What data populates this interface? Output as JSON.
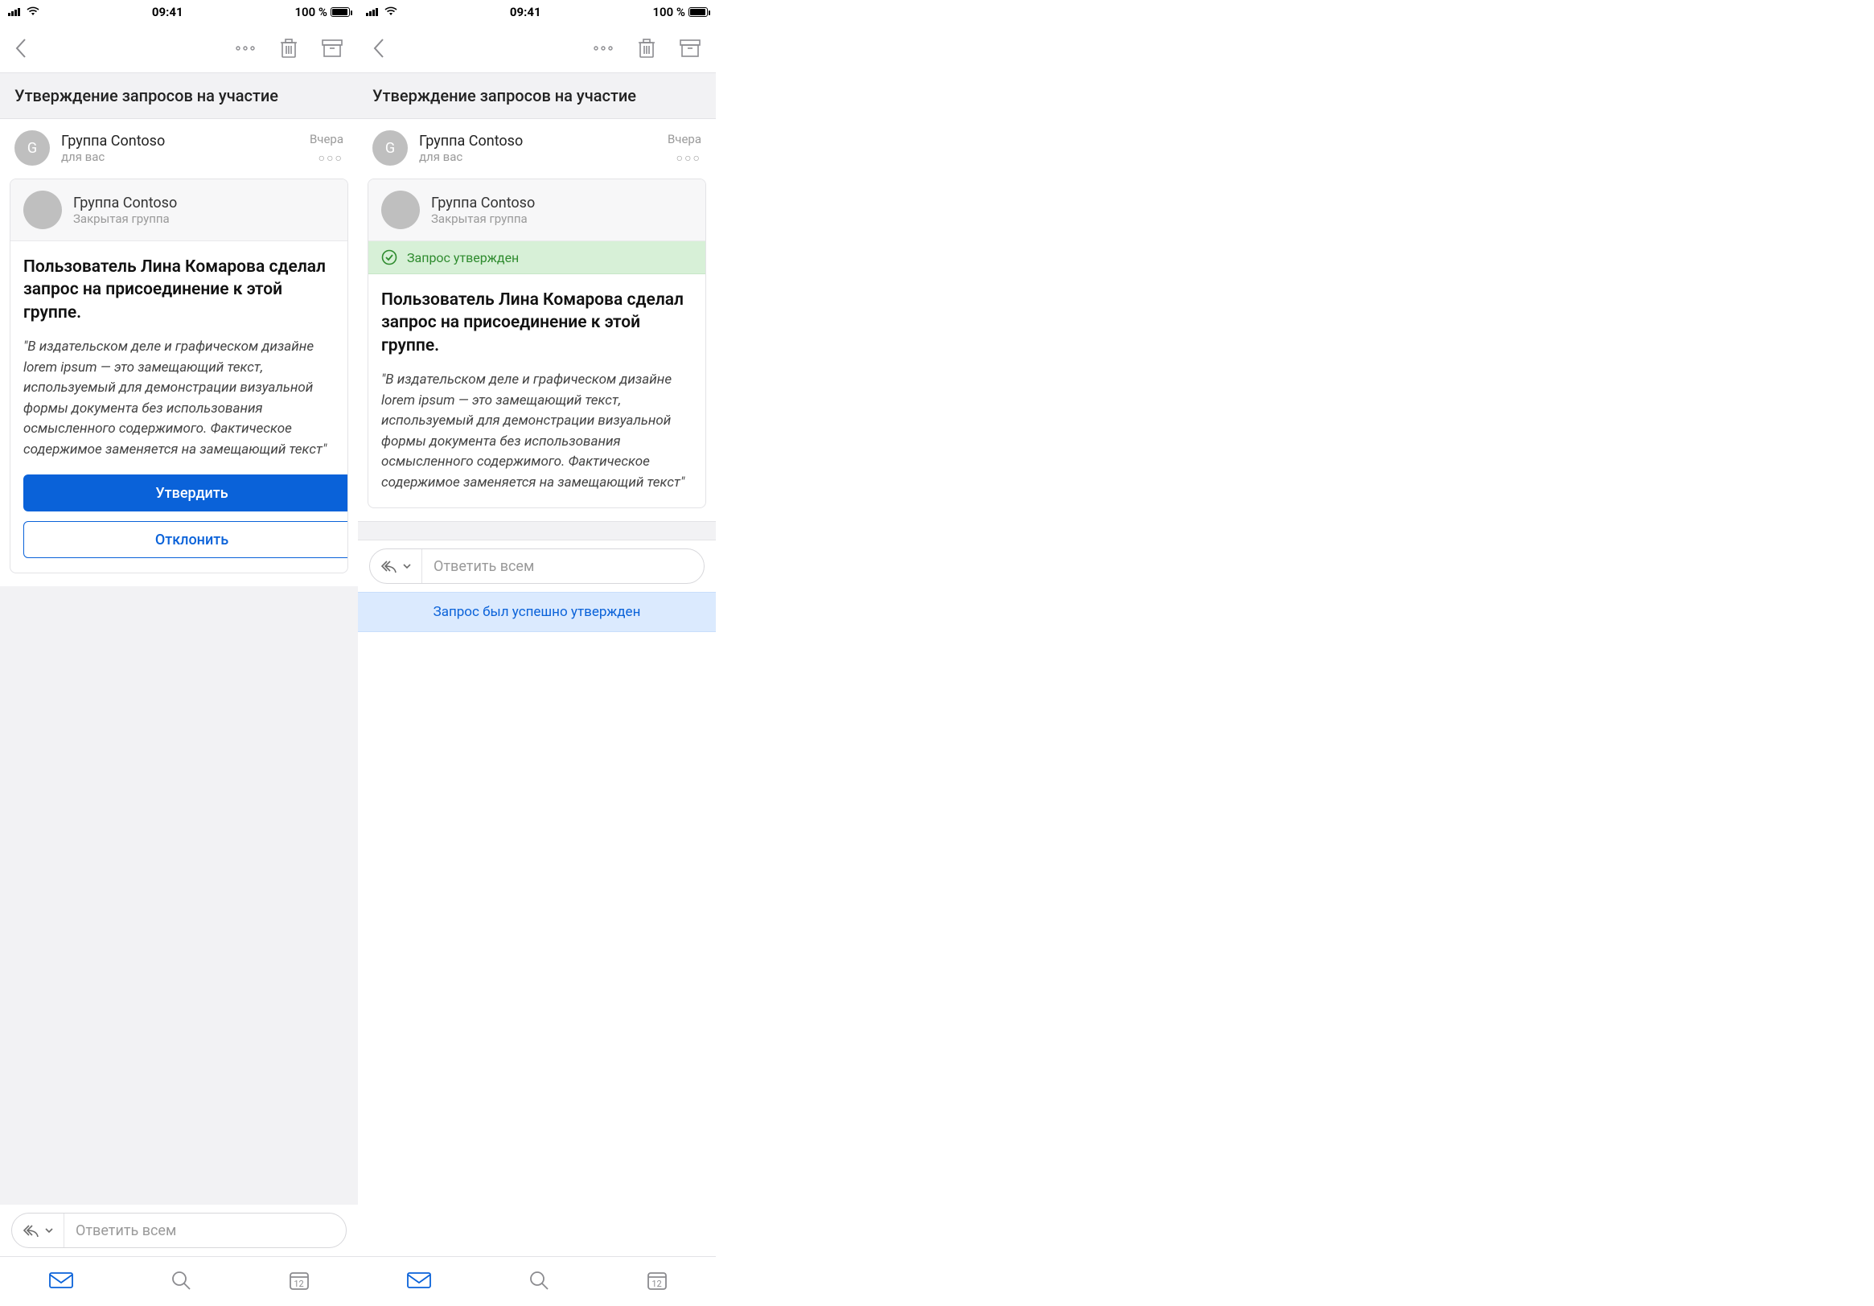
{
  "status": {
    "time": "09:41",
    "battery_pct": "100 %"
  },
  "header": {
    "subject": "Утверждение запросов на участие"
  },
  "sender": {
    "avatar_initial": "G",
    "name": "Группа Contoso",
    "to_line": "для вас",
    "timestamp": "Вчера"
  },
  "card": {
    "group_name": "Группа Contoso",
    "group_type": "Закрытая группа",
    "approved_text": "Запрос утвержден",
    "title": "Пользователь Лина Комарова сделал запрос на присоединение к этой группе.",
    "lorem": "\"В издательском деле и графическом дизайне lorem ipsum — это замещающий текст, используемый для демонстрации визуальной формы документа без использования осмысленного содержимого. Фактическое содержимое заменяется на замещающий текст\"",
    "approve_label": "Утвердить",
    "decline_label": "Отклонить"
  },
  "reply": {
    "placeholder": "Ответить всем"
  },
  "toast": {
    "text": "Запрос был успешно утвержден"
  },
  "tabbar": {
    "calendar_day": "12"
  }
}
